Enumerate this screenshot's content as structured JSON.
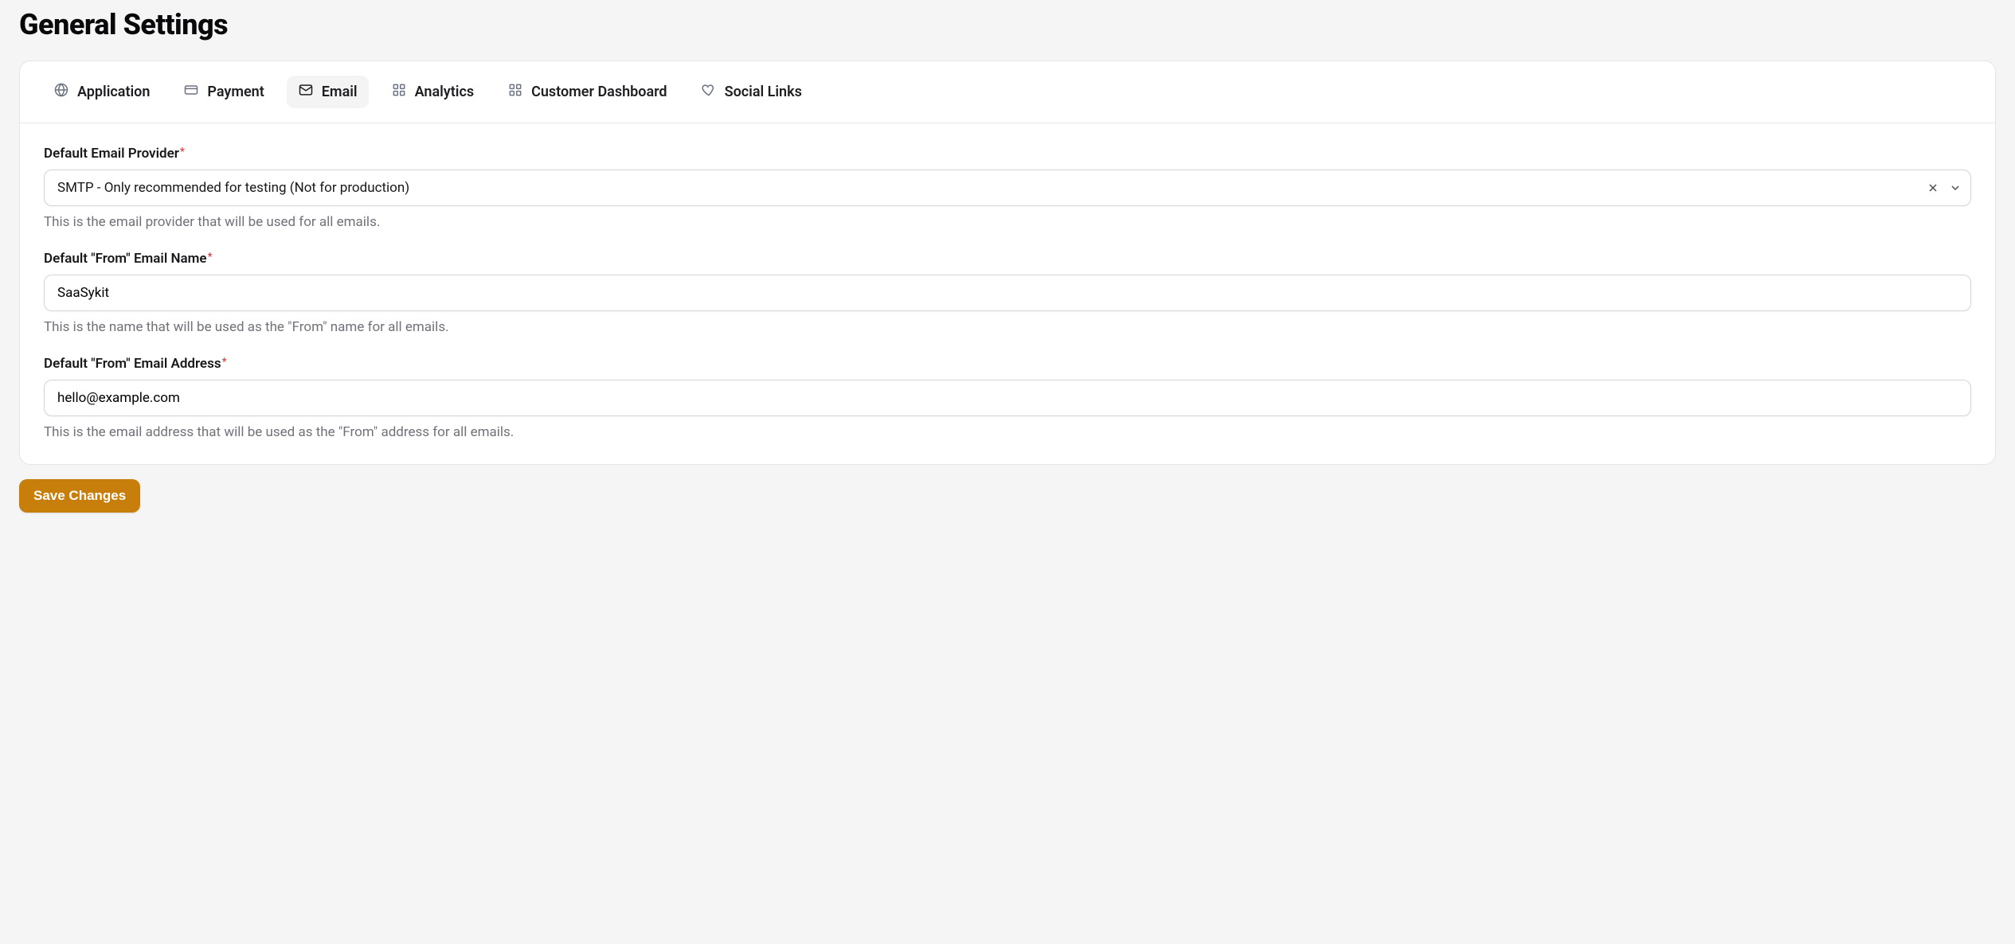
{
  "page": {
    "title": "General Settings"
  },
  "tabs": {
    "application": "Application",
    "payment": "Payment",
    "email": "Email",
    "analytics": "Analytics",
    "customer_dashboard": "Customer Dashboard",
    "social_links": "Social Links"
  },
  "form": {
    "provider": {
      "label": "Default Email Provider",
      "value": "SMTP - Only recommended for testing (Not for production)",
      "helper": "This is the email provider that will be used for all emails."
    },
    "from_name": {
      "label": "Default \"From\" Email Name",
      "value": "SaaSykit",
      "helper": "This is the name that will be used as the \"From\" name for all emails."
    },
    "from_address": {
      "label": "Default \"From\" Email Address",
      "value": "hello@example.com",
      "helper": "This is the email address that will be used as the \"From\" address for all emails."
    }
  },
  "actions": {
    "save": "Save Changes"
  }
}
